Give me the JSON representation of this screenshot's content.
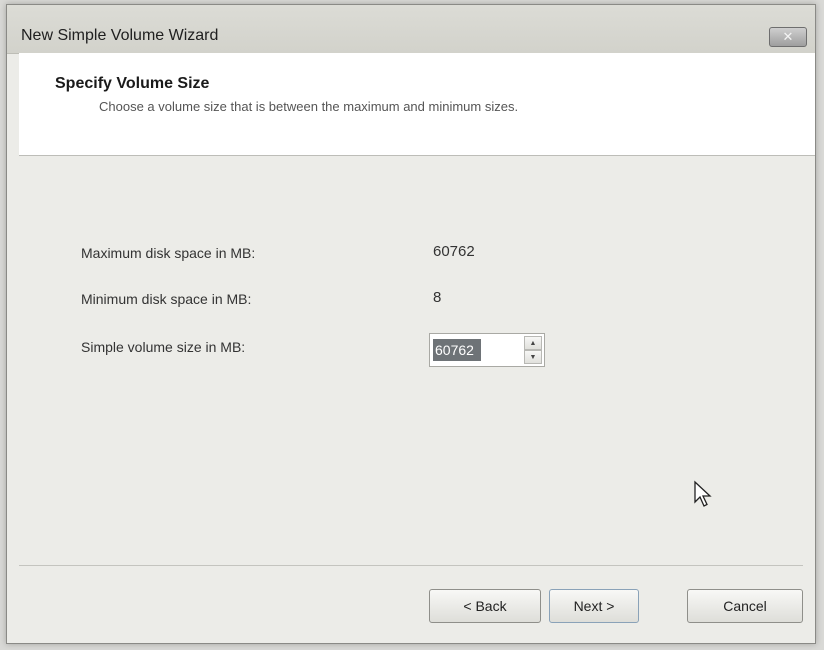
{
  "window": {
    "title": "New Simple Volume Wizard",
    "close_icon": "close-icon"
  },
  "header": {
    "title": "Specify Volume Size",
    "subtitle": "Choose a volume size that is between the maximum and minimum sizes."
  },
  "fields": {
    "max_label": "Maximum disk space in MB:",
    "max_value": "60762",
    "min_label": "Minimum disk space in MB:",
    "min_value": "8",
    "size_label": "Simple volume size in MB:",
    "size_value": "60762",
    "spin_up_icon": "chevron-up-icon",
    "spin_down_icon": "chevron-down-icon"
  },
  "buttons": {
    "back": "< Back",
    "next": "Next >",
    "cancel": "Cancel"
  },
  "colors": {
    "window_bg": "#ecece8",
    "header_bg": "#ffffff",
    "selection": "#6e7377"
  }
}
